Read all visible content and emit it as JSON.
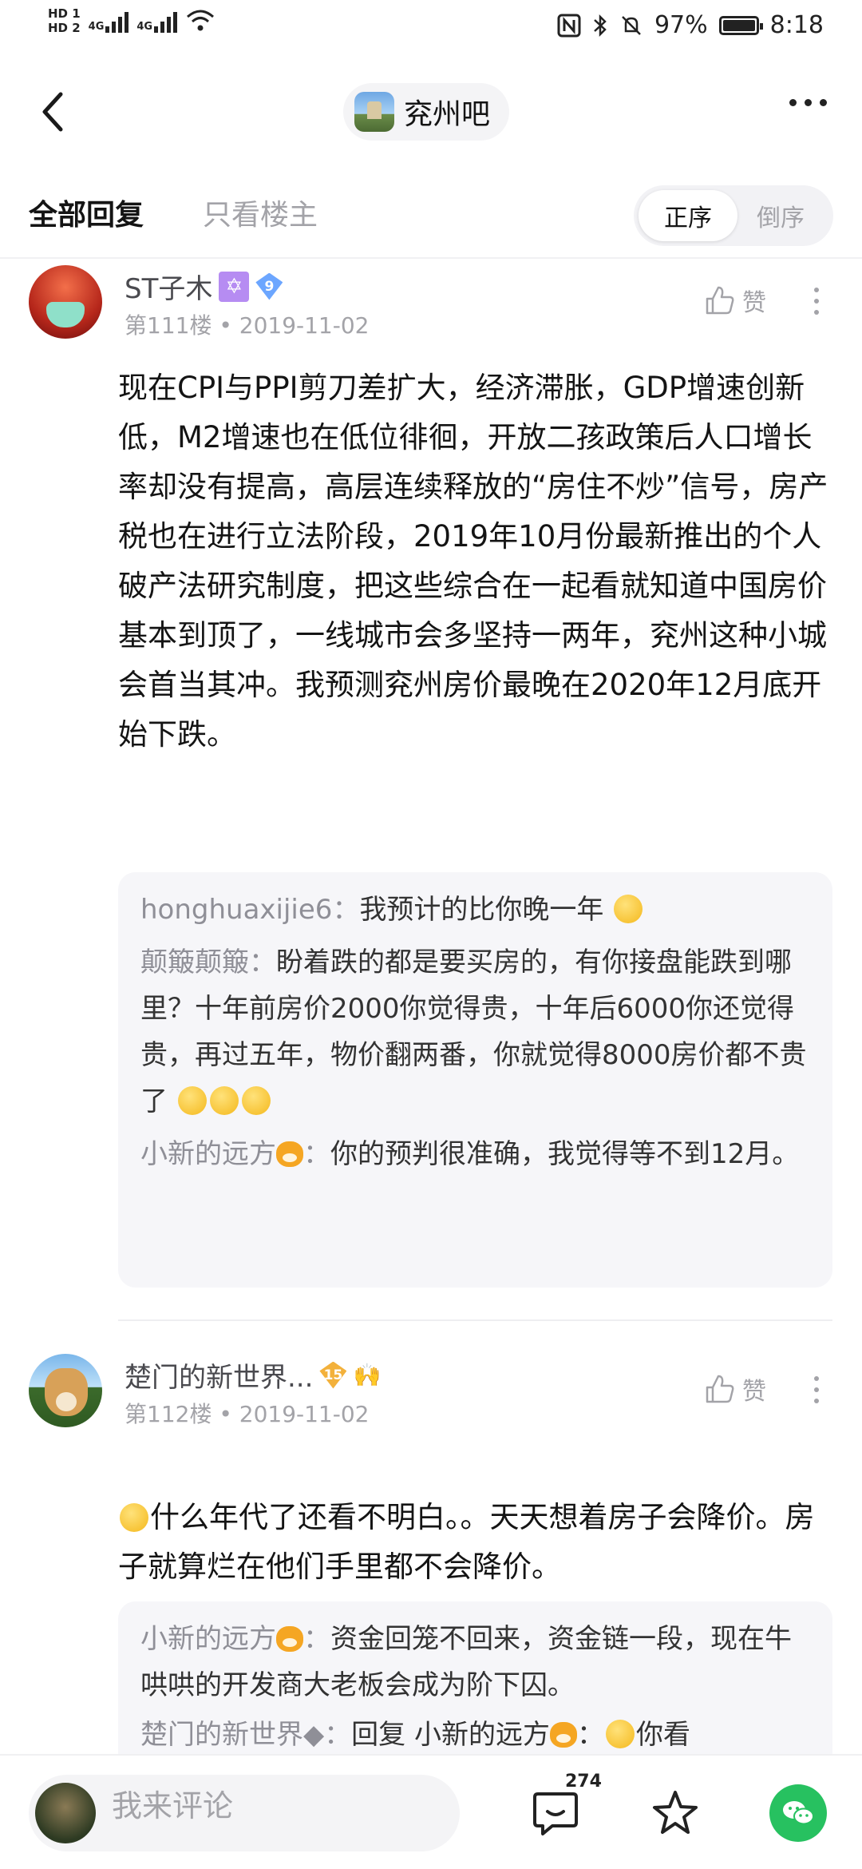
{
  "status_bar": {
    "hd1": "HD 1",
    "hd2": "HD 2",
    "net1": "4G",
    "net2": "4G",
    "battery_percent": "97%",
    "time": "8:18"
  },
  "nav": {
    "forum_name": "兖州吧"
  },
  "tabs": {
    "all_replies": "全部回复",
    "owner_only": "只看楼主",
    "sort_asc": "正序",
    "sort_desc": "倒序"
  },
  "posts": [
    {
      "username": "ST子木",
      "level": "9",
      "floor_date": "第111楼 • 2019-11-02",
      "like_label": "赞",
      "content": "现在CPI与PPI剪刀差扩大，经济滞胀，GDP增速创新低，M2增速也在低位徘徊，开放二孩政策后人口增长率却没有提高，高层连续释放的“房住不炒”信号，房产税也在进行立法阶段，2019年10月份最新推出的个人破产法研究制度，把这些综合在一起看就知道中国房价基本到顶了，一线城市会多坚持一两年，兖州这种小城会首当其冲。我预测兖州房价最晚在2020年12月底开始下跌。",
      "replies": [
        {
          "name": "honghuaxijie6",
          "text": "我预计的比你晚一年"
        },
        {
          "name": "颠簸颠簸",
          "text": "盼着跌的都是要买房的，有你接盘能跌到哪里？十年前房价2000你觉得贵，十年后6000你还觉得贵，再过五年，物价翻两番，你就觉得8000房价都不贵了"
        },
        {
          "name": "小新的远方",
          "text": "你的预判很准确，我觉得等不到12月。"
        }
      ]
    },
    {
      "username": "楚门的新世界...",
      "level": "15",
      "floor_date": "第112楼 • 2019-11-02",
      "like_label": "赞",
      "content": "什么年代了还看不明白。。天天想着房子会降价。房子就算烂在他们手里都不会降价。",
      "replies": [
        {
          "name": "小新的远方",
          "text": "资金回笼不回来，资金链一段，现在牛哄哄的开发商大老板会成为阶下囚。"
        },
        {
          "name": "楚门的新世界◆",
          "text": "回复 小新的远方",
          "tail": "你看"
        }
      ]
    }
  ],
  "bottom_bar": {
    "comment_placeholder": "我来评论",
    "reply_count": "274"
  }
}
